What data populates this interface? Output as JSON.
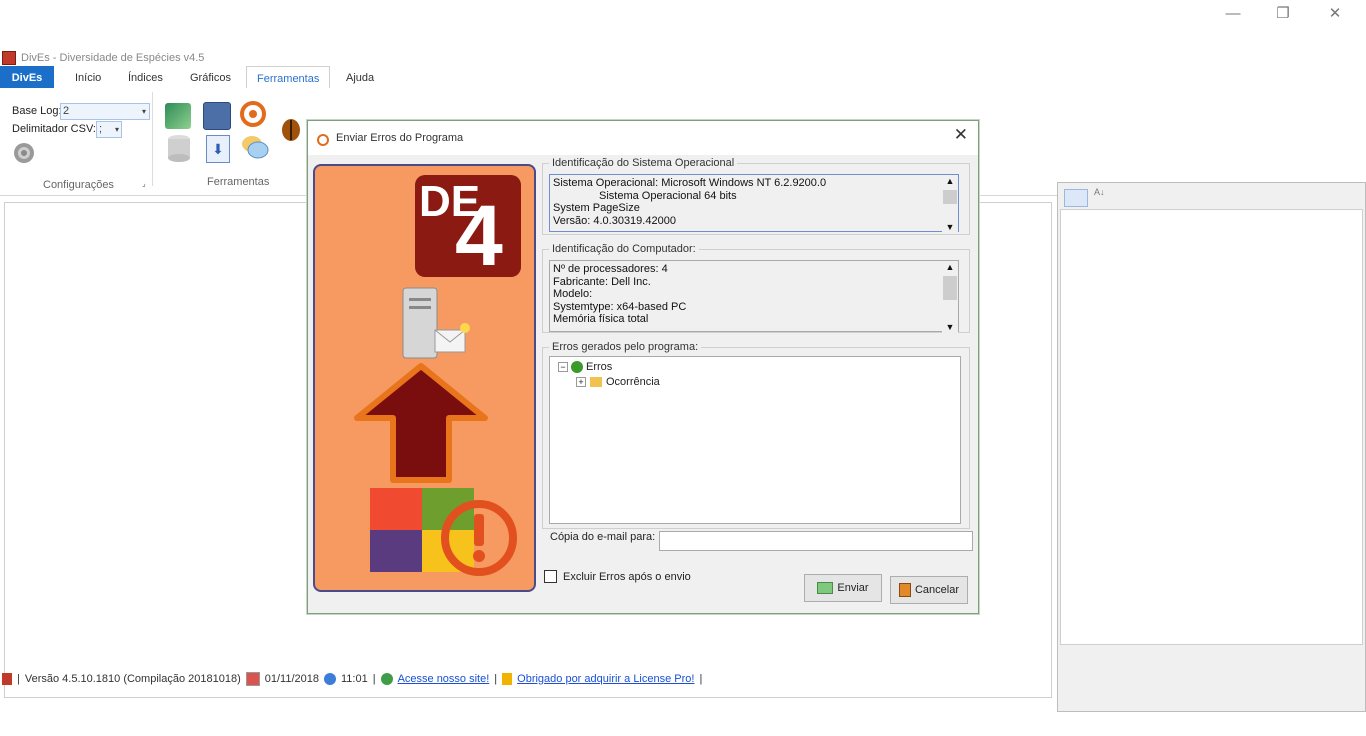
{
  "window": {
    "title": "DivEs - Diversidade de Espécies v4.5"
  },
  "ribbon": {
    "tabs": [
      {
        "label": "DivEs"
      },
      {
        "label": "Início"
      },
      {
        "label": "Índices"
      },
      {
        "label": "Gráficos"
      },
      {
        "label": "Ferramentas"
      },
      {
        "label": "Ajuda"
      }
    ],
    "config": {
      "base_log_label": "Base Log:",
      "base_log_value": "2",
      "delim_label": "Delimitador CSV:",
      "delim_value": ";",
      "group_label": "Configurações"
    },
    "tools_group_label": "Ferramentas"
  },
  "dialog": {
    "title": "Enviar Erros do Programa",
    "banner_text": "DE",
    "banner_num": "4",
    "os_section": {
      "legend": "Identificação do Sistema Operacional",
      "lines": [
        "Sistema Operacional: Microsoft Windows NT 6.2.9200.0",
        "Sistema Operacional 64 bits",
        "System PageSize",
        "Versão: 4.0.30319.42000"
      ]
    },
    "pc_section": {
      "legend": "Identificação do Computador:",
      "lines": [
        "Nº de processadores:  4",
        "Fabricante: Dell Inc.",
        "Modelo:",
        "Systemtype: x64-based PC",
        "Memória física total"
      ]
    },
    "errors_section": {
      "legend": "Erros gerados  pelo programa:",
      "tree_root": "Erros",
      "tree_child": "Ocorrência"
    },
    "email_label": "Cópia do e-mail para:",
    "email_value": "",
    "delete_checkbox_label": "Excluir Erros após o envio",
    "send_button": "Enviar",
    "cancel_button": "Cancelar"
  },
  "statusbar": {
    "version": "Versão 4.5.10.1810 (Compilação 20181018)",
    "date": "01/11/2018",
    "time": "11:01",
    "site_link": "Acesse nosso site!",
    "license_link": "Obrigado por adquirir a License Pro!"
  }
}
